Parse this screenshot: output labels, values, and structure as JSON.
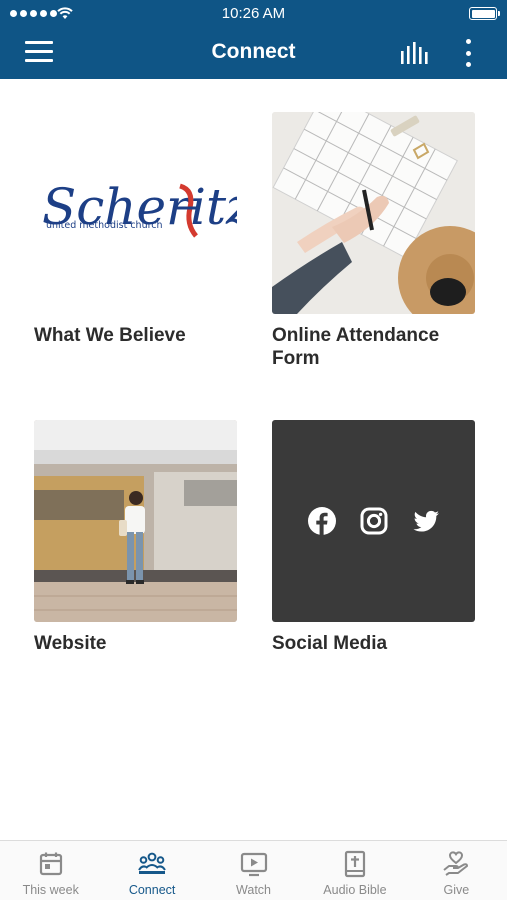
{
  "status_bar": {
    "time": "10:26 AM"
  },
  "app_bar": {
    "title": "Connect"
  },
  "tiles": [
    {
      "label": "What We Believe",
      "logo_text": "Scheritz",
      "logo_subtitle": "united methodist church"
    },
    {
      "label": "Online Attendance Form"
    },
    {
      "label": "Website"
    },
    {
      "label": "Social Media",
      "icons": [
        "facebook-icon",
        "instagram-icon",
        "twitter-icon"
      ]
    }
  ],
  "tab_bar": {
    "items": [
      {
        "label": "This week",
        "icon": "calendar-icon",
        "active": false
      },
      {
        "label": "Connect",
        "icon": "people-icon",
        "active": true
      },
      {
        "label": "Watch",
        "icon": "play-screen-icon",
        "active": false
      },
      {
        "label": "Audio Bible",
        "icon": "bible-icon",
        "active": false
      },
      {
        "label": "Give",
        "icon": "heart-hand-icon",
        "active": false
      }
    ]
  },
  "colors": {
    "header": "#0f5586",
    "accent": "#16588a",
    "tab_inactive": "#8a8a8a",
    "tile_label": "#2c2c2c",
    "social_bg": "#3a3a3a"
  }
}
